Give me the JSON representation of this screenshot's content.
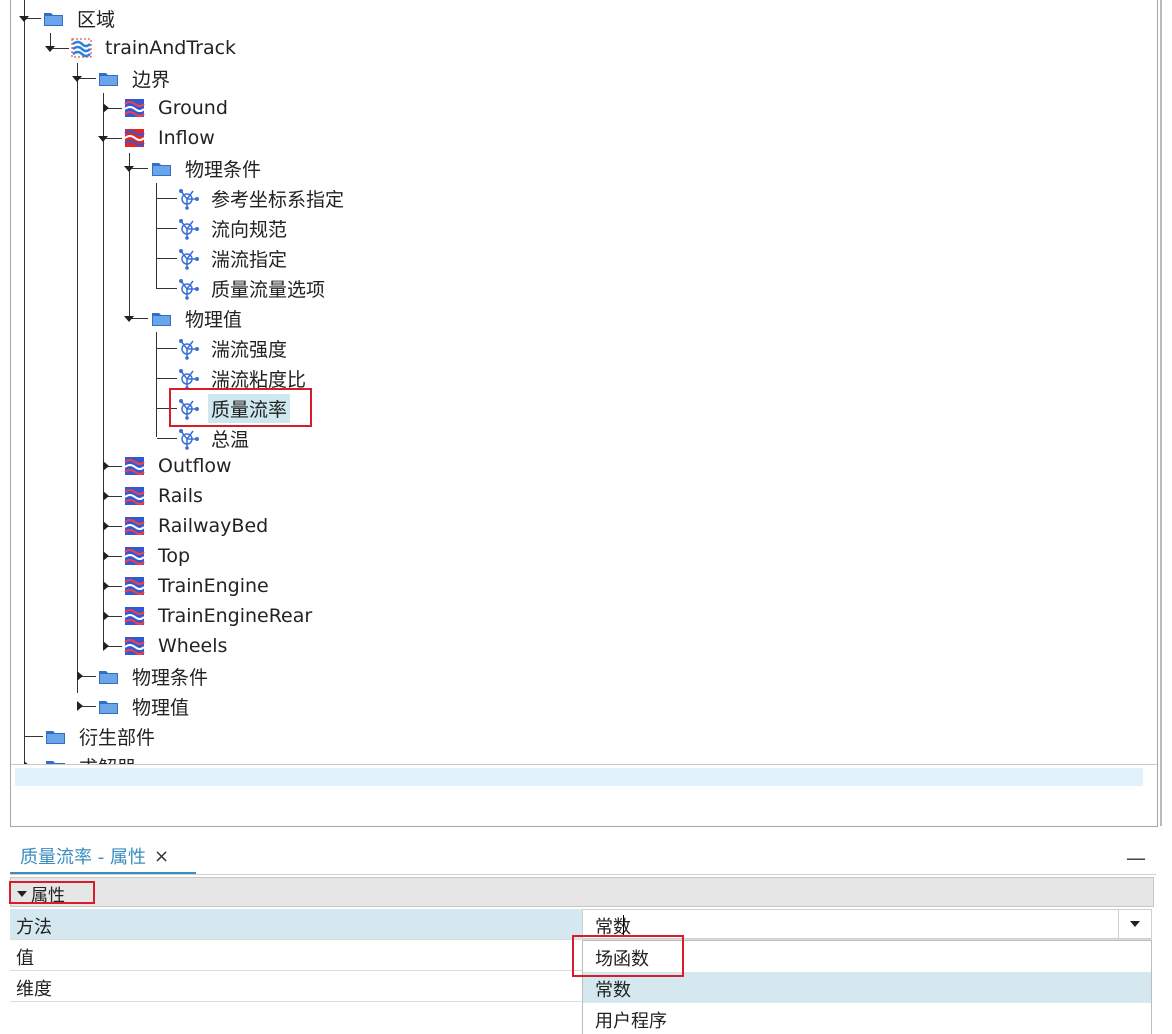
{
  "tree": {
    "nodes": [
      {
        "label": "区域",
        "icon": "folder-icon"
      },
      {
        "label": "trainAndTrack",
        "icon": "region-icon"
      },
      {
        "label": "边界",
        "icon": "folder-icon"
      },
      {
        "label": "Ground",
        "icon": "boundary-icon"
      },
      {
        "label": "Inflow",
        "icon": "inlet-boundary-icon"
      },
      {
        "label": "物理条件",
        "icon": "folder-icon"
      },
      {
        "label": "参考坐标系指定",
        "icon": "physics-value-icon"
      },
      {
        "label": "流向规范",
        "icon": "physics-value-icon"
      },
      {
        "label": "湍流指定",
        "icon": "physics-value-icon"
      },
      {
        "label": "质量流量选项",
        "icon": "physics-value-icon"
      },
      {
        "label": "物理值",
        "icon": "folder-icon"
      },
      {
        "label": "湍流强度",
        "icon": "physics-value-icon"
      },
      {
        "label": "湍流粘度比",
        "icon": "physics-value-icon"
      },
      {
        "label": "质量流率",
        "icon": "physics-value-icon"
      },
      {
        "label": "总温",
        "icon": "physics-value-icon"
      },
      {
        "label": "Outflow",
        "icon": "boundary-icon"
      },
      {
        "label": "Rails",
        "icon": "boundary-icon"
      },
      {
        "label": "RailwayBed",
        "icon": "boundary-icon"
      },
      {
        "label": "Top",
        "icon": "boundary-icon"
      },
      {
        "label": "TrainEngine",
        "icon": "boundary-icon"
      },
      {
        "label": "TrainEngineRear",
        "icon": "boundary-icon"
      },
      {
        "label": "Wheels",
        "icon": "boundary-icon"
      },
      {
        "label": "物理条件",
        "icon": "folder-icon"
      },
      {
        "label": "物理值",
        "icon": "folder-icon"
      },
      {
        "label": "衍生部件",
        "icon": "folder-icon"
      },
      {
        "label": "求解器",
        "icon": "folder-icon"
      }
    ],
    "selected": "质量流率"
  },
  "properties": {
    "tab_title": "质量流率 - 属性",
    "close_glyph": "×",
    "minimize_glyph": "—",
    "section": "属性",
    "rows": [
      {
        "name": "方法",
        "value": "常数"
      },
      {
        "name": "值",
        "value": ""
      },
      {
        "name": "维度",
        "value": ""
      }
    ],
    "options": [
      "场函数",
      "常数",
      "用户程序"
    ],
    "highlighted_option": "常数"
  },
  "colors": {
    "accent": "#3a8ec0",
    "selection": "#cfe7ee",
    "highlight_box": "#d61e2a",
    "folder": "#3b7fd1",
    "boundary": "#2d5bd8"
  }
}
